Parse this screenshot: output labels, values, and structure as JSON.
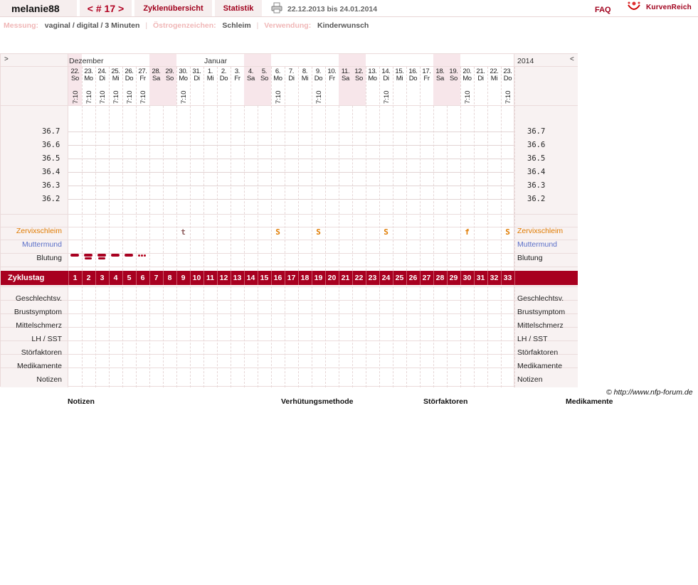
{
  "topbar": {
    "user": "melanie88",
    "cycle": "< # 17 >",
    "tab_overview": "Zyklenübersicht",
    "tab_stats": "Statistik",
    "date_range": "22.12.2013 bis 24.01.2014",
    "faq": "FAQ",
    "brand": "KurvenReich"
  },
  "info": {
    "measure_label": "Messung:",
    "measure_value": "vaginal / digital / 3 Minuten",
    "estrogen_label": "Östrogenzeichen:",
    "estrogen_value": "Schleim",
    "use_label": "Verwendung:",
    "use_value": "Kinderwunsch"
  },
  "chart": {
    "corner_left": ">",
    "corner_right": "<",
    "month_dec": "Dezember",
    "month_jan": "Januar",
    "year": "2014",
    "days": [
      {
        "d": "22.",
        "w": "So",
        "t": "7:10",
        "we": true
      },
      {
        "d": "23.",
        "w": "Mo",
        "t": "7:10",
        "we": false
      },
      {
        "d": "24.",
        "w": "Di",
        "t": "7:10",
        "we": false
      },
      {
        "d": "25.",
        "w": "Mi",
        "t": "7:10",
        "we": false
      },
      {
        "d": "26.",
        "w": "Do",
        "t": "7:10",
        "we": false
      },
      {
        "d": "27.",
        "w": "Fr",
        "t": "7:10",
        "we": false
      },
      {
        "d": "28.",
        "w": "Sa",
        "t": "",
        "we": true
      },
      {
        "d": "29.",
        "w": "So",
        "t": "",
        "we": true
      },
      {
        "d": "30.",
        "w": "Mo",
        "t": "7:10",
        "we": false
      },
      {
        "d": "31.",
        "w": "Di",
        "t": "",
        "we": false
      },
      {
        "d": "1.",
        "w": "Mi",
        "t": "",
        "we": false
      },
      {
        "d": "2.",
        "w": "Do",
        "t": "",
        "we": false
      },
      {
        "d": "3.",
        "w": "Fr",
        "t": "",
        "we": false
      },
      {
        "d": "4.",
        "w": "Sa",
        "t": "",
        "we": true
      },
      {
        "d": "5.",
        "w": "So",
        "t": "",
        "we": true
      },
      {
        "d": "6.",
        "w": "Mo",
        "t": "7:10",
        "we": false
      },
      {
        "d": "7.",
        "w": "Di",
        "t": "",
        "we": false
      },
      {
        "d": "8.",
        "w": "Mi",
        "t": "",
        "we": false
      },
      {
        "d": "9.",
        "w": "Do",
        "t": "7:10",
        "we": false
      },
      {
        "d": "10.",
        "w": "Fr",
        "t": "",
        "we": false
      },
      {
        "d": "11.",
        "w": "Sa",
        "t": "",
        "we": true
      },
      {
        "d": "12.",
        "w": "So",
        "t": "",
        "we": true
      },
      {
        "d": "13.",
        "w": "Mo",
        "t": "",
        "we": false
      },
      {
        "d": "14.",
        "w": "Di",
        "t": "7:10",
        "we": false
      },
      {
        "d": "15.",
        "w": "Mi",
        "t": "",
        "we": false
      },
      {
        "d": "16.",
        "w": "Do",
        "t": "",
        "we": false
      },
      {
        "d": "17.",
        "w": "Fr",
        "t": "",
        "we": false
      },
      {
        "d": "18.",
        "w": "Sa",
        "t": "",
        "we": true
      },
      {
        "d": "19.",
        "w": "So",
        "t": "",
        "we": true
      },
      {
        "d": "20.",
        "w": "Mo",
        "t": "7:10",
        "we": false
      },
      {
        "d": "21.",
        "w": "Di",
        "t": "",
        "we": false
      },
      {
        "d": "22.",
        "w": "Mi",
        "t": "",
        "we": false
      },
      {
        "d": "23.",
        "w": "Do",
        "t": "7:10",
        "we": false
      }
    ],
    "temps": [
      "36.7",
      "36.6",
      "36.5",
      "36.4",
      "36.3",
      "36.2"
    ],
    "rows": {
      "mucus": "Zervixschleim",
      "cervix": "Muttermund",
      "bleeding": "Blutung",
      "cycle_day": "Zyklustag",
      "sex": "Geschlechtsv.",
      "breast": "Brustsymptom",
      "midpain": "Mittelschmerz",
      "lh": "LH / SST",
      "disturb": "Störfaktoren",
      "meds": "Medikamente",
      "notes": "Notizen"
    },
    "mucus_entries": [
      {
        "day": 9,
        "v": "t"
      },
      {
        "day": 16,
        "v": "S"
      },
      {
        "day": 19,
        "v": "S"
      },
      {
        "day": 24,
        "v": "S"
      },
      {
        "day": 30,
        "v": "f"
      },
      {
        "day": 33,
        "v": "S"
      }
    ],
    "bleeding": [
      {
        "day": 1,
        "level": "medium"
      },
      {
        "day": 2,
        "level": "heavy"
      },
      {
        "day": 3,
        "level": "heavy"
      },
      {
        "day": 4,
        "level": "medium"
      },
      {
        "day": 5,
        "level": "medium"
      },
      {
        "day": 6,
        "level": "spotting"
      }
    ],
    "colors": {
      "accent": "#a80020",
      "mucus": "#e07b00",
      "cervix": "#5a6fc8",
      "weekend": "#f7e6ea"
    }
  },
  "footer": {
    "credit": "© http://www.nfp-forum.de",
    "notes": "Notizen",
    "method": "Verhütungsmethode",
    "disturb": "Störfaktoren",
    "meds": "Medikamente"
  }
}
